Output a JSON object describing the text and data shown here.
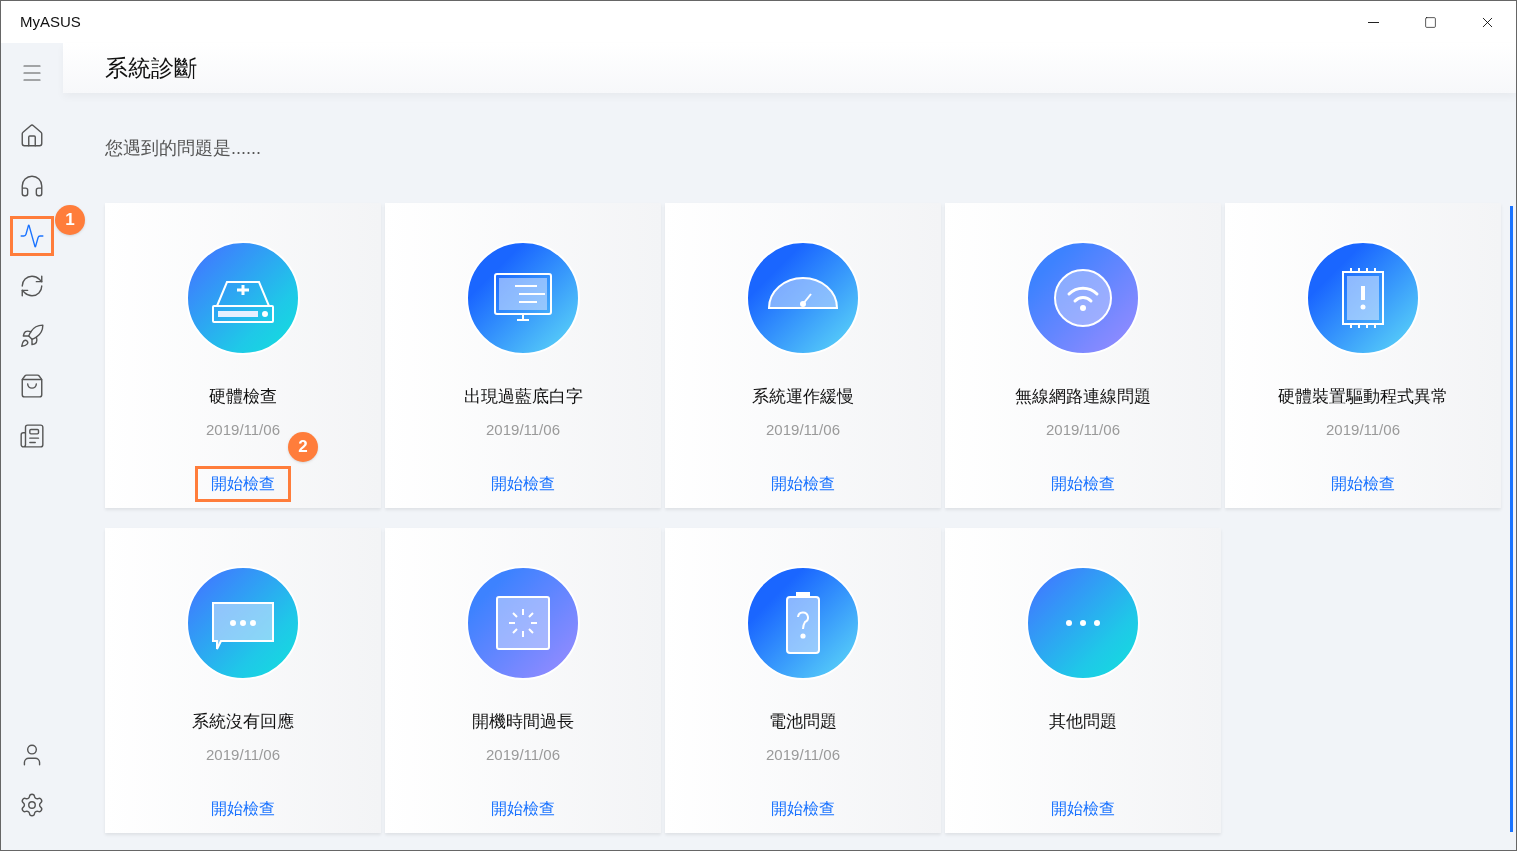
{
  "window": {
    "title": "MyASUS"
  },
  "sidebar": {
    "items": [
      {
        "kind": "home",
        "selected": false
      },
      {
        "kind": "headset",
        "selected": false
      },
      {
        "kind": "diagnosis",
        "selected": true,
        "callout": "1"
      },
      {
        "kind": "refresh",
        "selected": false
      },
      {
        "kind": "rocket",
        "selected": false
      },
      {
        "kind": "bag",
        "selected": false
      },
      {
        "kind": "news",
        "selected": false
      }
    ],
    "bottom_items": [
      {
        "kind": "user",
        "selected": false
      },
      {
        "kind": "settings",
        "selected": false
      }
    ]
  },
  "page": {
    "title": "系統診斷",
    "prompt": "您遇到的問題是......"
  },
  "cards": [
    {
      "kind": "drive",
      "title": "硬體檢查",
      "date": "2019/11/06",
      "action": "開始檢查",
      "callout": "2"
    },
    {
      "kind": "monitor",
      "title": "出現過藍底白字",
      "date": "2019/11/06",
      "action": "開始檢查"
    },
    {
      "kind": "gauge",
      "title": "系統運作緩慢",
      "date": "2019/11/06",
      "action": "開始檢查"
    },
    {
      "kind": "wifi",
      "title": "無線網路連線問題",
      "date": "2019/11/06",
      "action": "開始檢查"
    },
    {
      "kind": "chip",
      "title": "硬體裝置驅動程式異常",
      "date": "2019/11/06",
      "action": "開始檢查"
    },
    {
      "kind": "chat",
      "title": "系統沒有回應",
      "date": "2019/11/06",
      "action": "開始檢查"
    },
    {
      "kind": "loading",
      "title": "開機時間過長",
      "date": "2019/11/06",
      "action": "開始檢查"
    },
    {
      "kind": "battery",
      "title": "電池問題",
      "date": "2019/11/06",
      "action": "開始檢查"
    },
    {
      "kind": "dots",
      "title": "其他問題",
      "action": "開始檢查"
    }
  ]
}
